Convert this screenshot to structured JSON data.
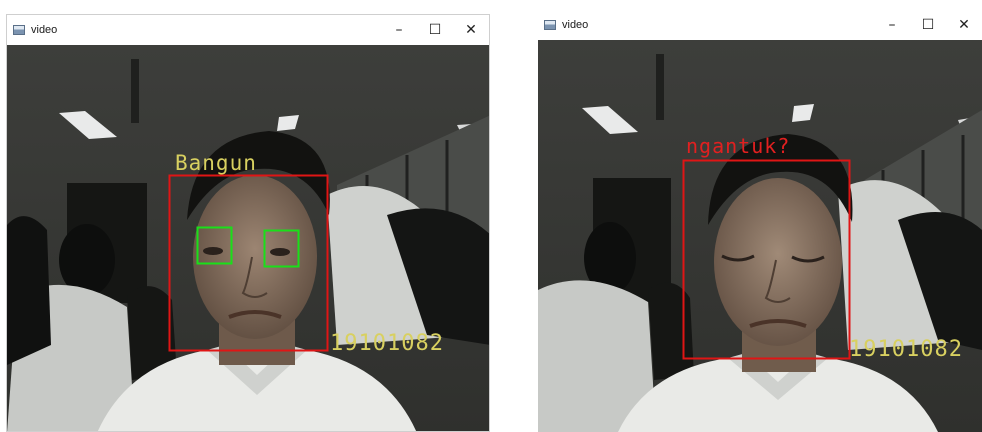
{
  "windows": [
    {
      "title": "video",
      "controls": {
        "minimize": "–",
        "maximize": "☐",
        "close": "✕"
      },
      "status_label": "Bangun",
      "id_label": "19101082",
      "colors": {
        "face_box": "#e01515",
        "eye_box": "#19e019",
        "status_text": "#d8d060",
        "id_text": "#d8d060"
      }
    },
    {
      "title": "video",
      "controls": {
        "minimize": "–",
        "maximize": "☐",
        "close": "✕"
      },
      "status_label": "ngantuk?",
      "id_label": "19101082",
      "colors": {
        "face_box": "#e01515",
        "status_text": "#e22020",
        "id_text": "#d8d060"
      }
    }
  ]
}
